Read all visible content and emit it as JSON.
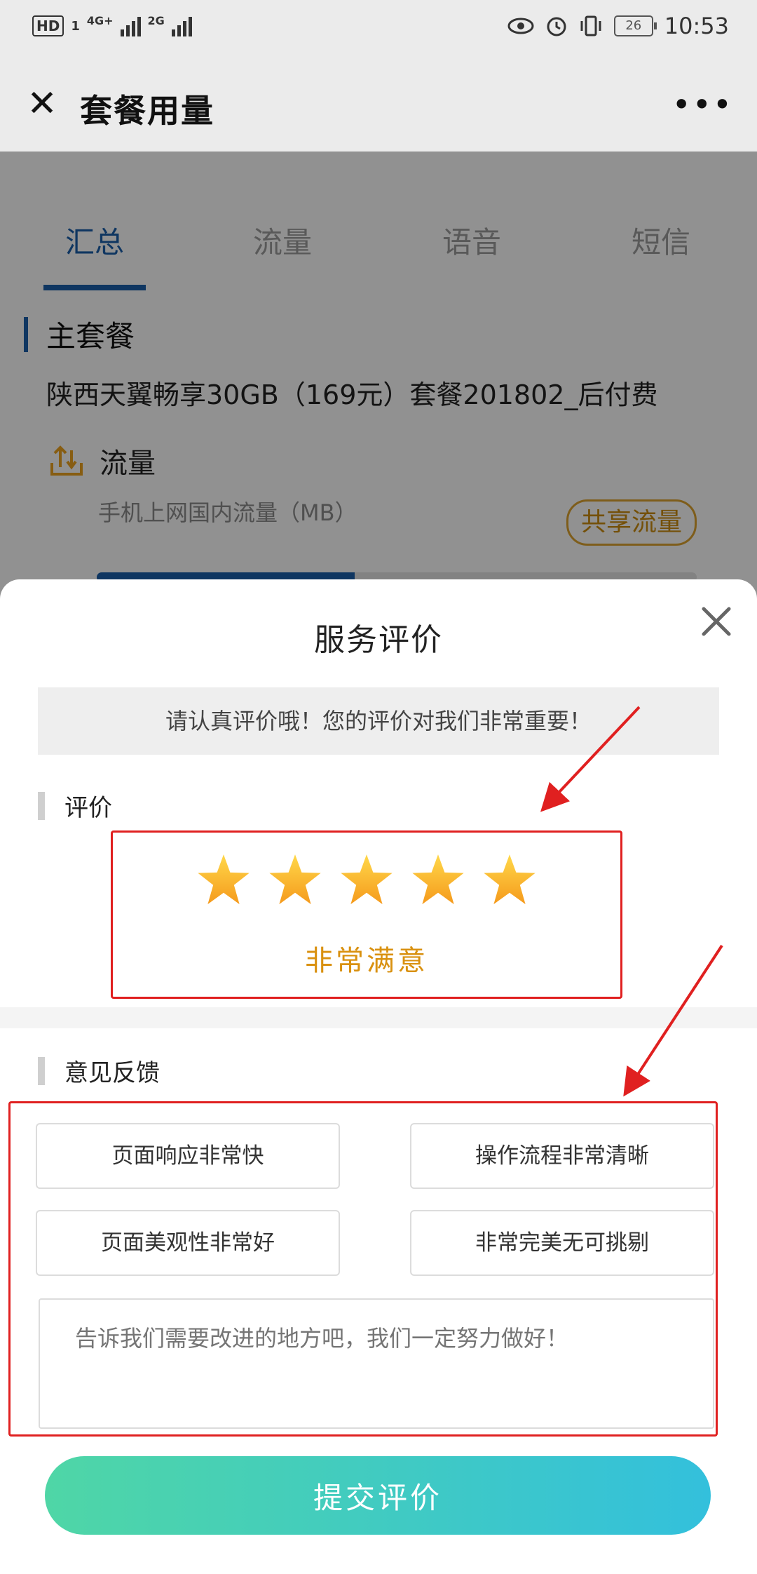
{
  "status_bar": {
    "hd_label": "HD",
    "sim1": "1",
    "net1": "4G+",
    "net2": "2G",
    "battery": "26",
    "time": "10:53"
  },
  "title_bar": {
    "close_icon": "close-icon",
    "title": "套餐用量",
    "more_icon": "more-icon"
  },
  "page": {
    "tabs": [
      {
        "label": "汇总",
        "active": true
      },
      {
        "label": "流量",
        "active": false
      },
      {
        "label": "语音",
        "active": false
      },
      {
        "label": "短信",
        "active": false
      }
    ],
    "section_title": "主套餐",
    "plan_name": "陕西天翼畅享30GB（169元）套餐201802_后付费",
    "flow_title": "流量",
    "flow_subtitle": "手机上网国内流量（MB）",
    "share_badge": "共享流量",
    "usage_fraction": 0.43
  },
  "modal": {
    "title": "服务评价",
    "close_icon": "close-icon",
    "notice": "请认真评价哦！您的评价对我们非常重要！",
    "rating_heading": "评价",
    "rating": {
      "stars_selected": 5,
      "stars_total": 5,
      "label": "非常满意",
      "star_color": "#f5b324"
    },
    "feedback_heading": "意见反馈",
    "tags": [
      "页面响应非常快",
      "操作流程非常清晰",
      "页面美观性非常好",
      "非常完美无可挑剔"
    ],
    "comment_placeholder": "告诉我们需要改进的地方吧，我们一定努力做好！",
    "submit_label": "提交评价"
  },
  "colors": {
    "accent": "#1b5ea8",
    "highlight_red": "#e02020",
    "button_gradient_start": "#4fd6a6",
    "button_gradient_end": "#33c0dc"
  }
}
